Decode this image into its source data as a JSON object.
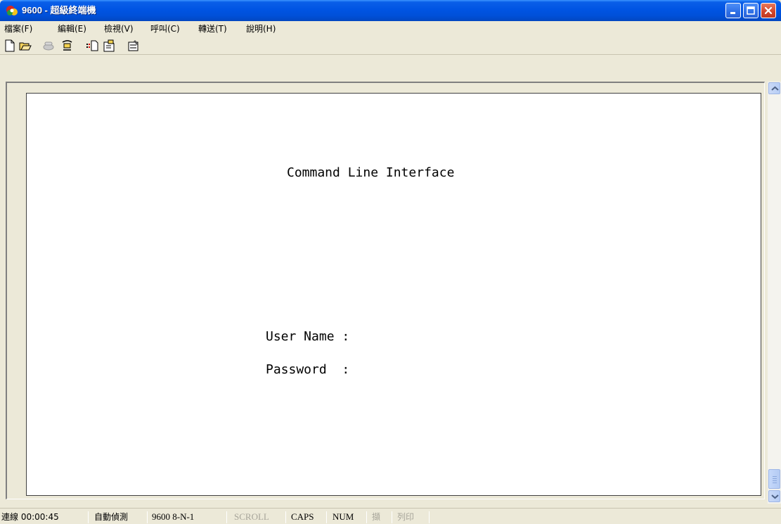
{
  "window": {
    "title": "9600 - 超級終端機",
    "icon": "hyperterminal-phone-icon",
    "controls": [
      "minimize-icon",
      "maximize-icon",
      "close-icon"
    ]
  },
  "menu": {
    "items": [
      {
        "label": "檔案(F)"
      },
      {
        "label": "編輯(E)"
      },
      {
        "label": "檢視(V)"
      },
      {
        "label": "呼叫(C)"
      },
      {
        "label": "轉送(T)"
      },
      {
        "label": "說明(H)"
      }
    ]
  },
  "toolbar": {
    "tools": [
      {
        "icon": "new-connection-icon"
      },
      {
        "icon": "open-folder-icon"
      },
      {
        "icon": "call-phone-icon"
      },
      {
        "icon": "disconnect-phone-icon"
      },
      {
        "icon": "send-file-icon"
      },
      {
        "icon": "receive-file-icon"
      },
      {
        "icon": "properties-icon"
      }
    ]
  },
  "terminal": {
    "heading": "Command Line Interface",
    "username_label": "User Name :",
    "password_label": "Password  :"
  },
  "status": {
    "connected_time": "連線 00:00:45",
    "detect": "自動偵測",
    "settings": "9600 8-N-1",
    "scroll": "SCROLL",
    "caps": "CAPS",
    "num": "NUM",
    "capture": "擷",
    "print": "列印"
  },
  "colors": {
    "titlebar": "#0054e3",
    "chrome": "#ece9d8",
    "terminal_bg": "#ffffff"
  }
}
